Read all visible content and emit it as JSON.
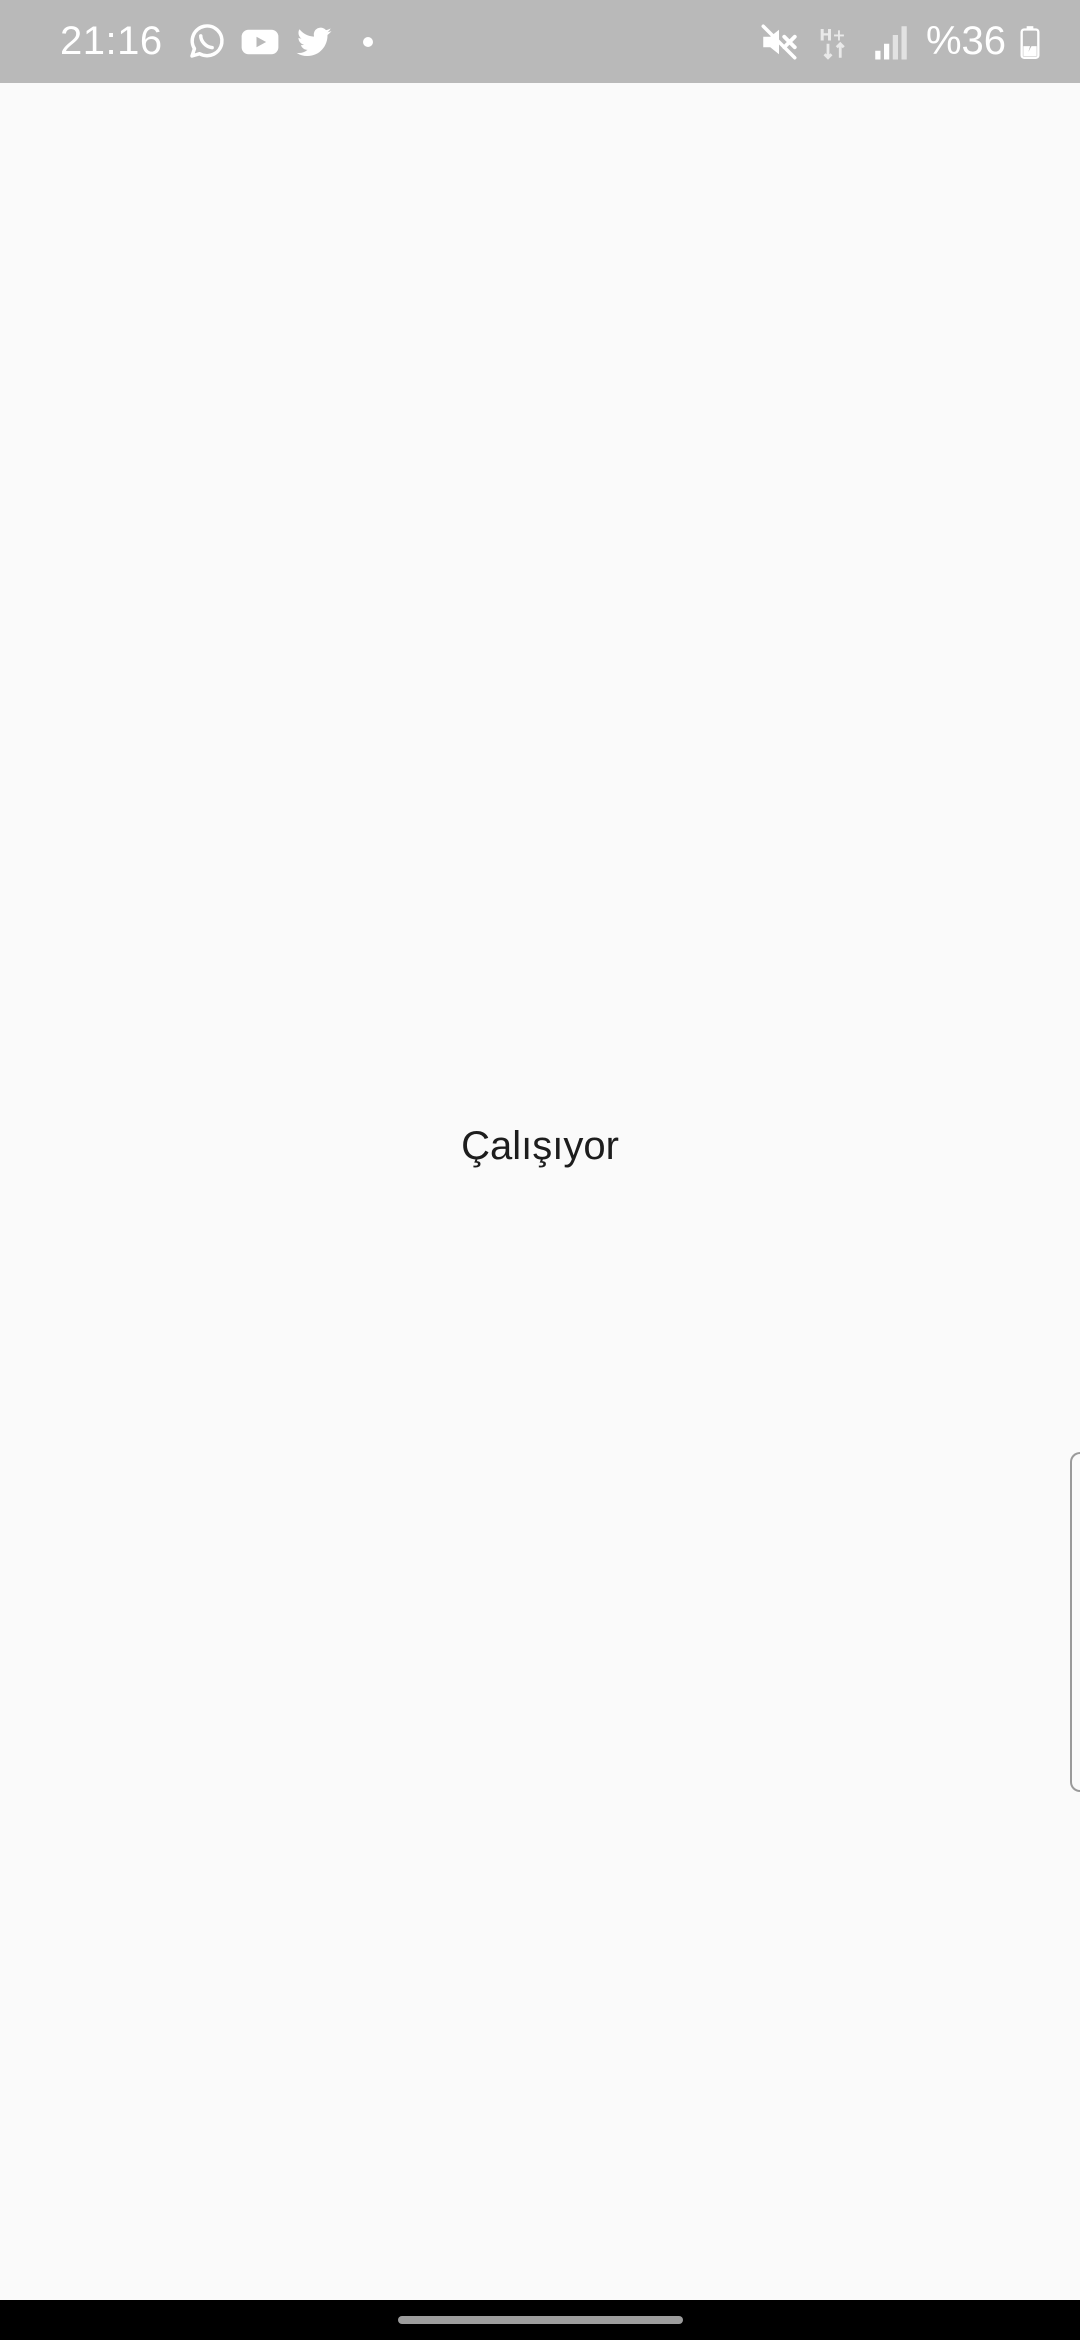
{
  "status_bar": {
    "time": "21:16",
    "battery_text": "%36",
    "notification_icons": [
      "whatsapp-icon",
      "youtube-icon",
      "twitter-icon",
      "more-notifications-dot"
    ],
    "system_icons": [
      "mute-icon",
      "hplus-data-icon",
      "signal-icon",
      "battery-charging-icon"
    ]
  },
  "main": {
    "status_text": "Çalışıyor"
  },
  "colors": {
    "status_bar_bg": "#b9b9b9",
    "background": "#fafafa",
    "text": "#1d1d1d",
    "nav_bar_bg": "#000000"
  }
}
